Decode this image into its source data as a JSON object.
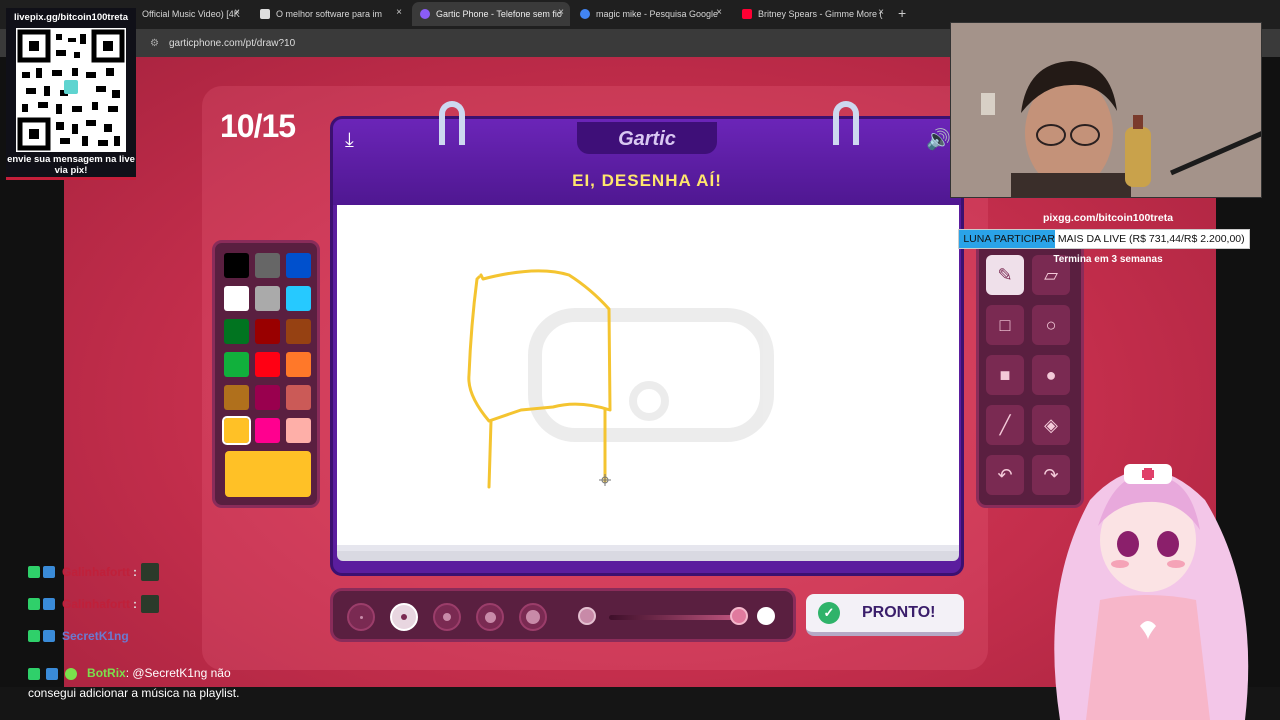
{
  "browser": {
    "tabs": [
      {
        "title": "Official Music Video) [4K",
        "favicon_color": "#ff0033",
        "active": false
      },
      {
        "title": "O melhor software para im",
        "favicon_color": "#dddddd",
        "active": false
      },
      {
        "title": "Gartic Phone - Telefone sem fio",
        "favicon_color": "#8b5cf6",
        "active": true
      },
      {
        "title": "magic mike - Pesquisa Google",
        "favicon_color": "#4285f4",
        "active": false
      },
      {
        "title": "Britney Spears - Gimme More (",
        "favicon_color": "#ff0033",
        "active": false
      }
    ],
    "new_tab_label": "+",
    "close_label": "×",
    "url": "garticphone.com/pt/draw?10"
  },
  "game": {
    "round": "10/15",
    "logo": "Gartic",
    "headline": "EI, DESENHA AÍ!",
    "ready_label": "PRONTO!",
    "palette": [
      "#000000",
      "#666666",
      "#0050cd",
      "#ffffff",
      "#aaaaaa",
      "#26c9ff",
      "#017420",
      "#990000",
      "#964112",
      "#11b03c",
      "#ff0013",
      "#ff7829",
      "#b0701c",
      "#99004e",
      "#cb5a57",
      "#ffc126",
      "#ff008f",
      "#feafa8"
    ],
    "selected_color": "#ffc126",
    "brush_sizes": 5,
    "selected_brush": 2,
    "opacity_level": 1.0,
    "tools": [
      "pencil-icon",
      "eraser-icon",
      "square-outline-icon",
      "circle-outline-icon",
      "square-filled-icon",
      "circle-filled-icon",
      "line-icon",
      "fill-bucket-icon",
      "undo-icon",
      "redo-icon"
    ],
    "selected_tool": "pencil-icon"
  },
  "overlay": {
    "qr_title": "livepix.gg/bitcoin100treta",
    "qr_message": "envie sua mensagem na live via pix!",
    "donation_url": "pixgg.com/bitcoin100treta",
    "donation_text": "LUNA PARTICIPAR MAIS DA LIVE (R$ 731,44/R$ 2.200,00)",
    "donation_progress": 0.3325,
    "donation_time": "Termina em 3 semanas",
    "chat": [
      {
        "user": "Galinhafortt",
        "color": "#c0203a",
        "suffix": ":"
      },
      {
        "user": "Galinhafortt",
        "color": "#c0203a",
        "suffix": ":"
      },
      {
        "user": "SecretK1ng",
        "color": "#6a7ad0",
        "suffix": ""
      }
    ],
    "bot_name": "BotRix",
    "bot_text": ": @SecretK1ng não",
    "bot_text2": "consegui adicionar a música na playlist."
  }
}
